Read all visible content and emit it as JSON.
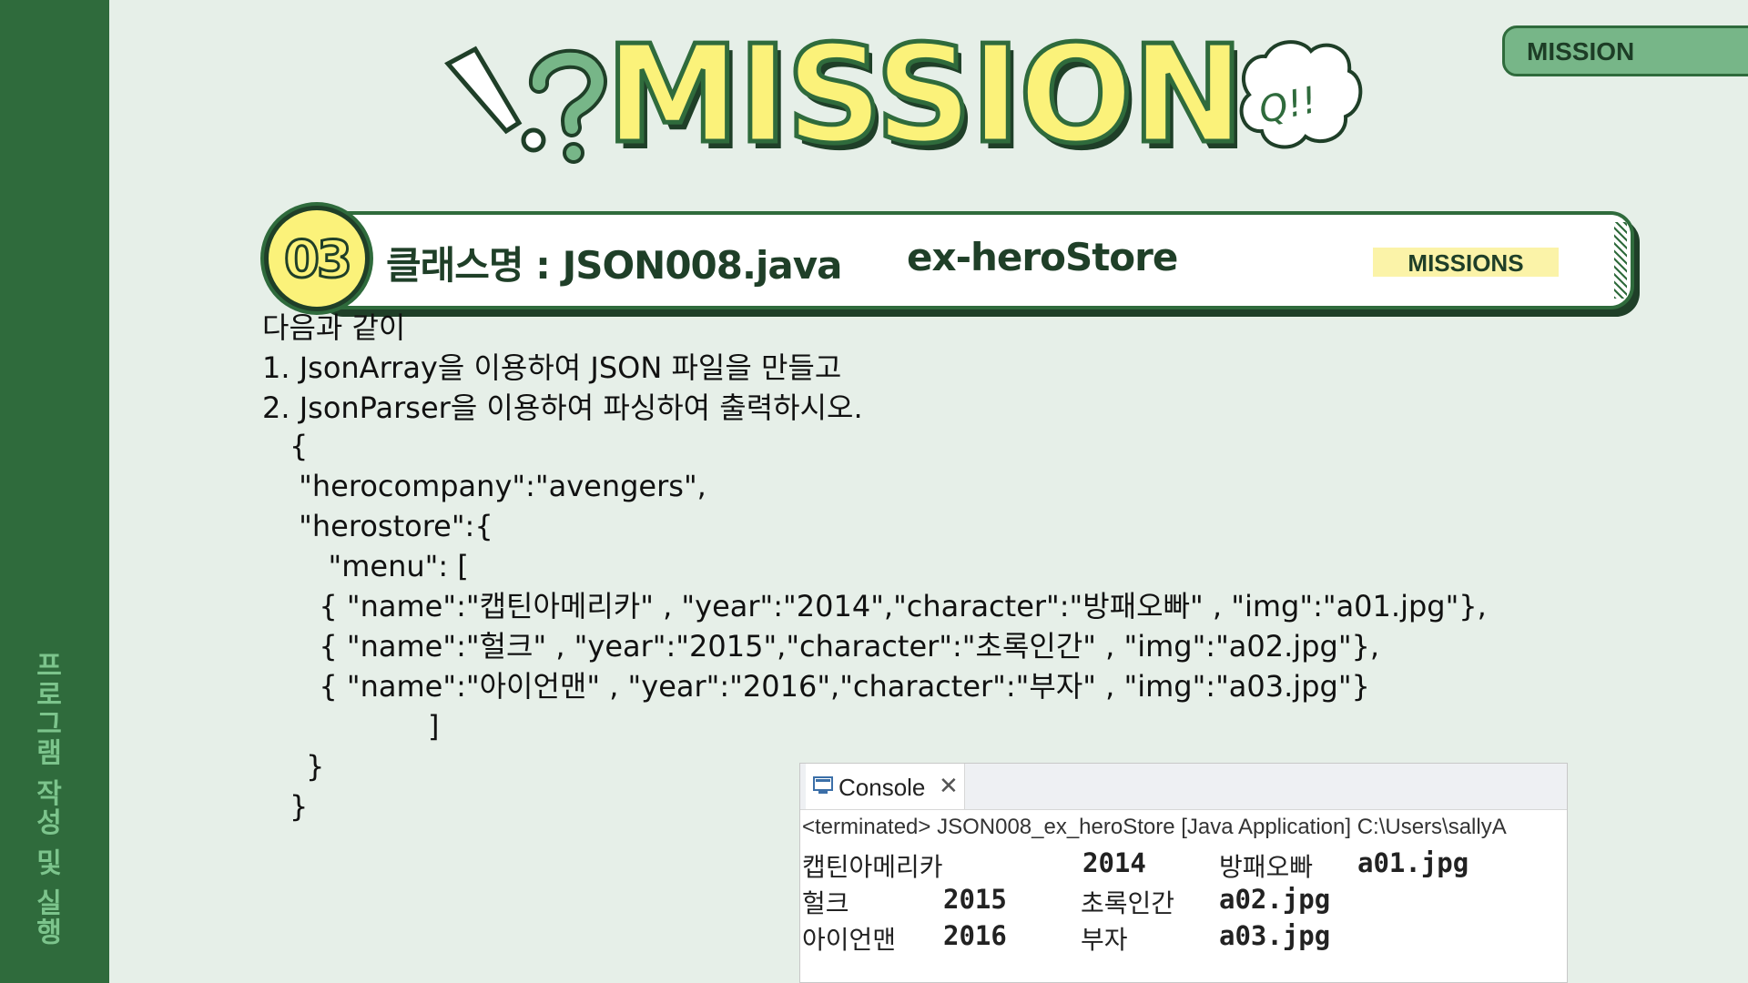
{
  "sidebar": {
    "caption": "프로그램 작성 및 실행"
  },
  "top_tag": {
    "label": "MISSION"
  },
  "header": {
    "title": "MISSION",
    "bubble_text": "Q!!",
    "mission_number": "03",
    "class_name": "클래스명 : JSON008.java",
    "store_name": "ex-heroStore",
    "chip_label": "MISSIONS"
  },
  "instructions": [
    "다음과 같이",
    "1. JsonArray을 이용하여 JSON 파일을 만들고",
    "2. JsonParser을 이용하여 파싱하여 출력하시오."
  ],
  "code_lines": [
    "{",
    " \"herocompany\":\"avengers\",",
    " \"herostore\":{",
    "   \"menu\": [",
    "  { \"name\":\"캡틴아메리카\" , \"year\":\"2014\",\"character\":\"방패오빠\" , \"img\":\"a01.jpg\"},",
    "  { \"name\":\"헐크\" , \"year\":\"2015\",\"character\":\"초록인간\" , \"img\":\"a02.jpg\"},",
    "  { \"name\":\"아이언맨\" , \"year\":\"2016\",\"character\":\"부자\" , \"img\":\"a03.jpg\"}",
    "]",
    "}",
    "}"
  ],
  "console": {
    "tab_label": "Console",
    "close_glyph": "✕",
    "status": "<terminated> JSON008_ex_heroStore [Java Application] C:\\Users\\sallyA",
    "rows": [
      {
        "name": "캡틴아메리카",
        "year": "2014",
        "character": "방패오빠",
        "img": "a01.jpg"
      },
      {
        "name": "헐크",
        "year": "2015",
        "character": "초록인간",
        "img": "a02.jpg"
      },
      {
        "name": "아이언맨",
        "year": "2016",
        "character": "부자",
        "img": "a03.jpg"
      }
    ]
  },
  "colors": {
    "background": "#e6efe8",
    "rail_green": "#2f6b3c",
    "title_yellow": "#fbf27a",
    "chip_yellow": "#fbf3a8"
  },
  "icons": [
    "exclamation-icon",
    "question-icon",
    "speech-bubble-icon",
    "console-icon",
    "close-icon"
  ]
}
